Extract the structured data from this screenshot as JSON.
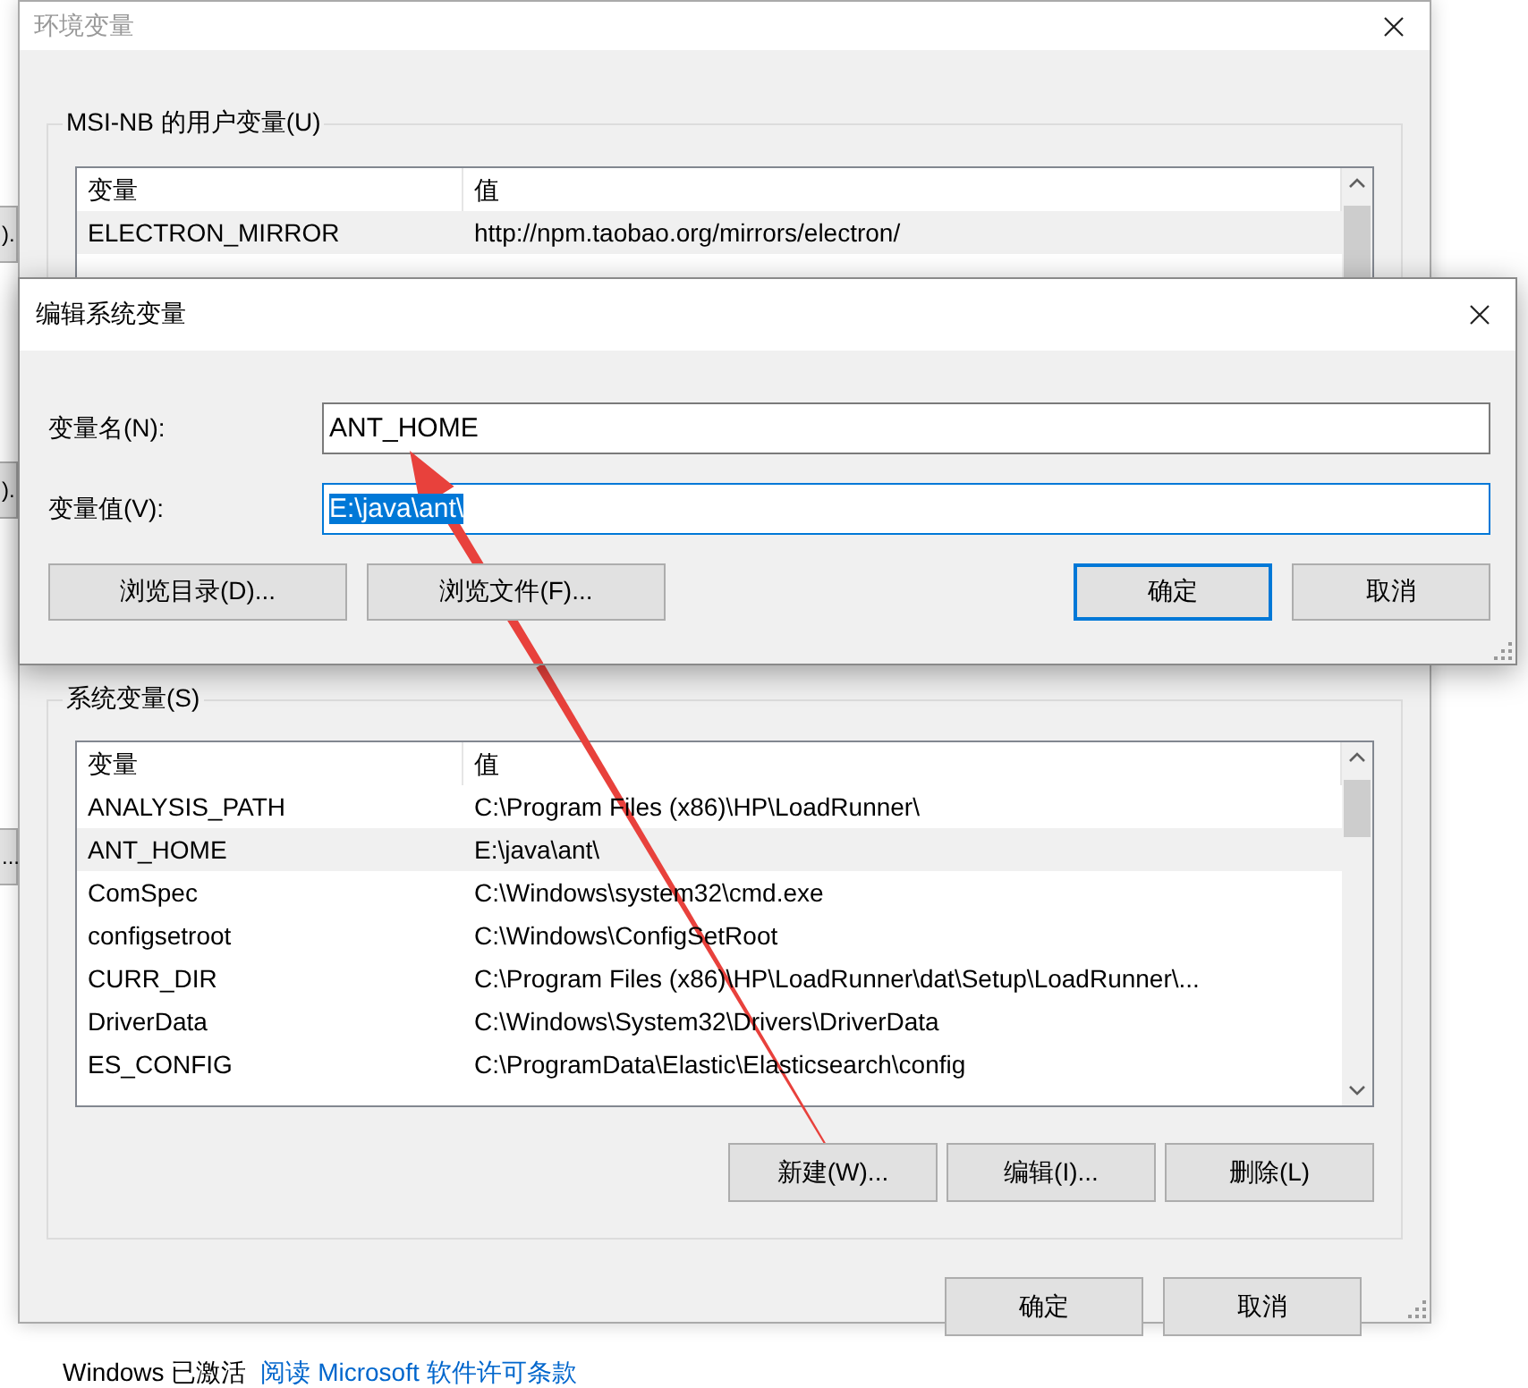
{
  "background": {
    "left_buttons": [
      {
        "label": ")."
      },
      {
        "label": ")."
      },
      {
        "label": "..."
      }
    ],
    "activation": {
      "text": "Windows 已激活",
      "link": "阅读 Microsoft 软件许可条款"
    }
  },
  "env_window": {
    "title": "环境变量",
    "active": false,
    "user_vars": {
      "title": "MSI-NB 的用户变量(U)",
      "columns": [
        "变量",
        "值"
      ],
      "rows": [
        {
          "name": "ELECTRON_MIRROR",
          "value": "http://npm.taobao.org/mirrors/electron/",
          "selected": true
        }
      ]
    },
    "system_vars": {
      "title": "系统变量(S)",
      "columns": [
        "变量",
        "值"
      ],
      "rows": [
        {
          "name": "ANALYSIS_PATH",
          "value": "C:\\Program Files (x86)\\HP\\LoadRunner\\",
          "selected": false
        },
        {
          "name": "ANT_HOME",
          "value": "E:\\java\\ant\\",
          "selected": true
        },
        {
          "name": "ComSpec",
          "value": "C:\\Windows\\system32\\cmd.exe",
          "selected": false
        },
        {
          "name": "configsetroot",
          "value": "C:\\Windows\\ConfigSetRoot",
          "selected": false
        },
        {
          "name": "CURR_DIR",
          "value": "C:\\Program Files (x86)\\HP\\LoadRunner\\dat\\Setup\\LoadRunner\\...",
          "selected": false
        },
        {
          "name": "DriverData",
          "value": "C:\\Windows\\System32\\Drivers\\DriverData",
          "selected": false
        },
        {
          "name": "ES_CONFIG",
          "value": "C:\\ProgramData\\Elastic\\Elasticsearch\\config",
          "selected": false
        }
      ],
      "buttons": [
        "新建(W)...",
        "编辑(I)...",
        "删除(L)"
      ]
    },
    "buttons": [
      {
        "label": "确定",
        "default": false
      },
      {
        "label": "取消",
        "default": false
      }
    ]
  },
  "edit_dialog": {
    "title": "编辑系统变量",
    "active": true,
    "fields": [
      {
        "label": "变量名(N):",
        "value": "ANT_HOME",
        "focused": false,
        "text_selected": false
      },
      {
        "label": "变量值(V):",
        "value": "E:\\java\\ant\\",
        "focused": true,
        "text_selected": true
      }
    ],
    "browse_buttons": [
      "浏览目录(D)...",
      "浏览文件(F)..."
    ],
    "buttons": [
      {
        "label": "确定",
        "default": true
      },
      {
        "label": "取消",
        "default": false
      }
    ]
  }
}
